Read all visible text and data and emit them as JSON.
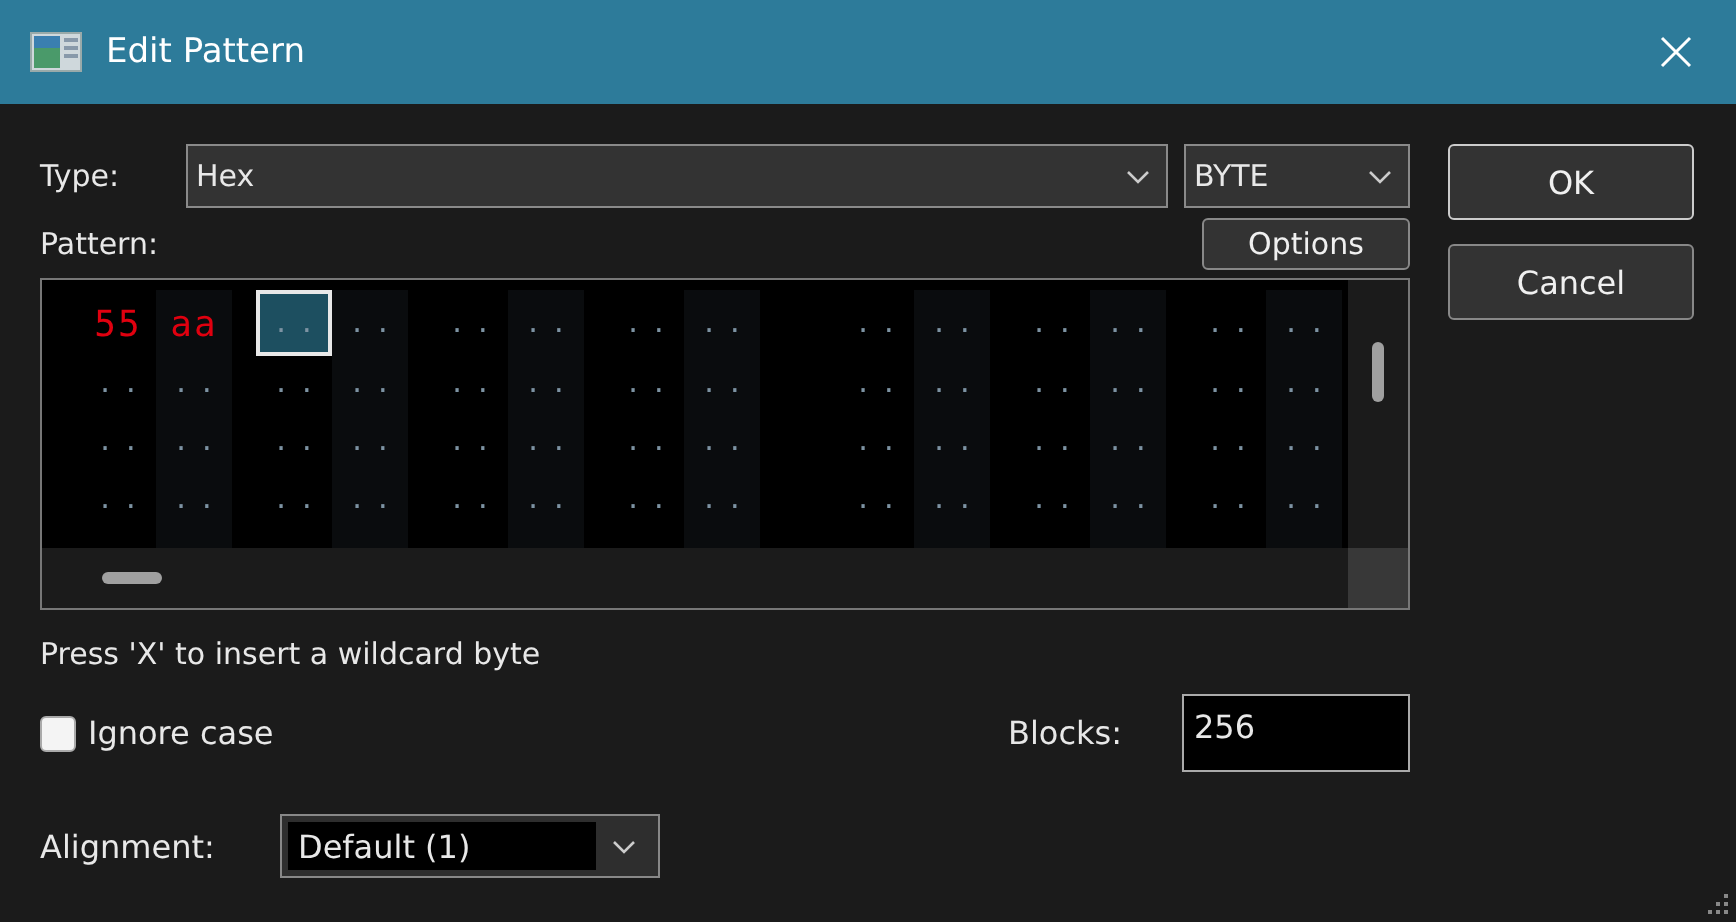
{
  "window": {
    "title": "Edit Pattern"
  },
  "type": {
    "label": "Type:",
    "value": "Hex",
    "unit": "BYTE"
  },
  "pattern": {
    "label": "Pattern:",
    "options_button": "Options",
    "rows": [
      [
        {
          "text": "55",
          "kind": "byte",
          "selected": false
        },
        {
          "text": "aa",
          "kind": "byte",
          "selected": false
        },
        {
          "text": "..",
          "kind": "wildcard",
          "selected": true
        },
        {
          "text": "..",
          "kind": "wildcard",
          "selected": false
        },
        {
          "text": "..",
          "kind": "wildcard",
          "selected": false
        },
        {
          "text": "..",
          "kind": "wildcard",
          "selected": false
        },
        {
          "text": "..",
          "kind": "wildcard",
          "selected": false
        },
        {
          "text": "..",
          "kind": "wildcard",
          "selected": false
        },
        {
          "text": "..",
          "kind": "wildcard",
          "selected": false
        },
        {
          "text": "..",
          "kind": "wildcard",
          "selected": false
        },
        {
          "text": "..",
          "kind": "wildcard",
          "selected": false
        },
        {
          "text": "..",
          "kind": "wildcard",
          "selected": false
        },
        {
          "text": "..",
          "kind": "wildcard",
          "selected": false
        },
        {
          "text": "..",
          "kind": "wildcard",
          "selected": false
        }
      ],
      [
        {
          "text": "..",
          "kind": "wildcard",
          "selected": false
        },
        {
          "text": "..",
          "kind": "wildcard",
          "selected": false
        },
        {
          "text": "..",
          "kind": "wildcard",
          "selected": false
        },
        {
          "text": "..",
          "kind": "wildcard",
          "selected": false
        },
        {
          "text": "..",
          "kind": "wildcard",
          "selected": false
        },
        {
          "text": "..",
          "kind": "wildcard",
          "selected": false
        },
        {
          "text": "..",
          "kind": "wildcard",
          "selected": false
        },
        {
          "text": "..",
          "kind": "wildcard",
          "selected": false
        },
        {
          "text": "..",
          "kind": "wildcard",
          "selected": false
        },
        {
          "text": "..",
          "kind": "wildcard",
          "selected": false
        },
        {
          "text": "..",
          "kind": "wildcard",
          "selected": false
        },
        {
          "text": "..",
          "kind": "wildcard",
          "selected": false
        },
        {
          "text": "..",
          "kind": "wildcard",
          "selected": false
        },
        {
          "text": "..",
          "kind": "wildcard",
          "selected": false
        }
      ],
      [
        {
          "text": "..",
          "kind": "wildcard",
          "selected": false
        },
        {
          "text": "..",
          "kind": "wildcard",
          "selected": false
        },
        {
          "text": "..",
          "kind": "wildcard",
          "selected": false
        },
        {
          "text": "..",
          "kind": "wildcard",
          "selected": false
        },
        {
          "text": "..",
          "kind": "wildcard",
          "selected": false
        },
        {
          "text": "..",
          "kind": "wildcard",
          "selected": false
        },
        {
          "text": "..",
          "kind": "wildcard",
          "selected": false
        },
        {
          "text": "..",
          "kind": "wildcard",
          "selected": false
        },
        {
          "text": "..",
          "kind": "wildcard",
          "selected": false
        },
        {
          "text": "..",
          "kind": "wildcard",
          "selected": false
        },
        {
          "text": "..",
          "kind": "wildcard",
          "selected": false
        },
        {
          "text": "..",
          "kind": "wildcard",
          "selected": false
        },
        {
          "text": "..",
          "kind": "wildcard",
          "selected": false
        },
        {
          "text": "..",
          "kind": "wildcard",
          "selected": false
        }
      ],
      [
        {
          "text": "..",
          "kind": "wildcard",
          "selected": false
        },
        {
          "text": "..",
          "kind": "wildcard",
          "selected": false
        },
        {
          "text": "..",
          "kind": "wildcard",
          "selected": false
        },
        {
          "text": "..",
          "kind": "wildcard",
          "selected": false
        },
        {
          "text": "..",
          "kind": "wildcard",
          "selected": false
        },
        {
          "text": "..",
          "kind": "wildcard",
          "selected": false
        },
        {
          "text": "..",
          "kind": "wildcard",
          "selected": false
        },
        {
          "text": "..",
          "kind": "wildcard",
          "selected": false
        },
        {
          "text": "..",
          "kind": "wildcard",
          "selected": false
        },
        {
          "text": "..",
          "kind": "wildcard",
          "selected": false
        },
        {
          "text": "..",
          "kind": "wildcard",
          "selected": false
        },
        {
          "text": "..",
          "kind": "wildcard",
          "selected": false
        },
        {
          "text": "..",
          "kind": "wildcard",
          "selected": false
        },
        {
          "text": "..",
          "kind": "wildcard",
          "selected": false
        }
      ]
    ]
  },
  "hint": "Press 'X' to insert a wildcard byte",
  "ignore_case": {
    "label": "Ignore case",
    "checked": false
  },
  "blocks": {
    "label": "Blocks:",
    "value": "256"
  },
  "alignment": {
    "label": "Alignment:",
    "value": "Default (1)"
  },
  "buttons": [
    "OK",
    "Cancel"
  ]
}
